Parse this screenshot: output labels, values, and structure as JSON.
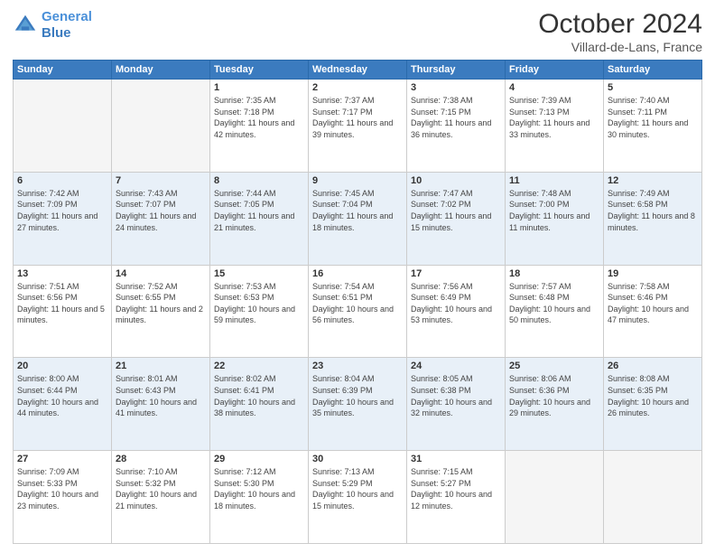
{
  "header": {
    "logo_line1": "General",
    "logo_line2": "Blue",
    "main_title": "October 2024",
    "subtitle": "Villard-de-Lans, France"
  },
  "days_of_week": [
    "Sunday",
    "Monday",
    "Tuesday",
    "Wednesday",
    "Thursday",
    "Friday",
    "Saturday"
  ],
  "weeks": [
    [
      {
        "day": "",
        "empty": true
      },
      {
        "day": "",
        "empty": true
      },
      {
        "day": "1",
        "sunrise": "7:35 AM",
        "sunset": "7:18 PM",
        "daylight": "11 hours and 42 minutes."
      },
      {
        "day": "2",
        "sunrise": "7:37 AM",
        "sunset": "7:17 PM",
        "daylight": "11 hours and 39 minutes."
      },
      {
        "day": "3",
        "sunrise": "7:38 AM",
        "sunset": "7:15 PM",
        "daylight": "11 hours and 36 minutes."
      },
      {
        "day": "4",
        "sunrise": "7:39 AM",
        "sunset": "7:13 PM",
        "daylight": "11 hours and 33 minutes."
      },
      {
        "day": "5",
        "sunrise": "7:40 AM",
        "sunset": "7:11 PM",
        "daylight": "11 hours and 30 minutes."
      }
    ],
    [
      {
        "day": "6",
        "sunrise": "7:42 AM",
        "sunset": "7:09 PM",
        "daylight": "11 hours and 27 minutes."
      },
      {
        "day": "7",
        "sunrise": "7:43 AM",
        "sunset": "7:07 PM",
        "daylight": "11 hours and 24 minutes."
      },
      {
        "day": "8",
        "sunrise": "7:44 AM",
        "sunset": "7:05 PM",
        "daylight": "11 hours and 21 minutes."
      },
      {
        "day": "9",
        "sunrise": "7:45 AM",
        "sunset": "7:04 PM",
        "daylight": "11 hours and 18 minutes."
      },
      {
        "day": "10",
        "sunrise": "7:47 AM",
        "sunset": "7:02 PM",
        "daylight": "11 hours and 15 minutes."
      },
      {
        "day": "11",
        "sunrise": "7:48 AM",
        "sunset": "7:00 PM",
        "daylight": "11 hours and 11 minutes."
      },
      {
        "day": "12",
        "sunrise": "7:49 AM",
        "sunset": "6:58 PM",
        "daylight": "11 hours and 8 minutes."
      }
    ],
    [
      {
        "day": "13",
        "sunrise": "7:51 AM",
        "sunset": "6:56 PM",
        "daylight": "11 hours and 5 minutes."
      },
      {
        "day": "14",
        "sunrise": "7:52 AM",
        "sunset": "6:55 PM",
        "daylight": "11 hours and 2 minutes."
      },
      {
        "day": "15",
        "sunrise": "7:53 AM",
        "sunset": "6:53 PM",
        "daylight": "10 hours and 59 minutes."
      },
      {
        "day": "16",
        "sunrise": "7:54 AM",
        "sunset": "6:51 PM",
        "daylight": "10 hours and 56 minutes."
      },
      {
        "day": "17",
        "sunrise": "7:56 AM",
        "sunset": "6:49 PM",
        "daylight": "10 hours and 53 minutes."
      },
      {
        "day": "18",
        "sunrise": "7:57 AM",
        "sunset": "6:48 PM",
        "daylight": "10 hours and 50 minutes."
      },
      {
        "day": "19",
        "sunrise": "7:58 AM",
        "sunset": "6:46 PM",
        "daylight": "10 hours and 47 minutes."
      }
    ],
    [
      {
        "day": "20",
        "sunrise": "8:00 AM",
        "sunset": "6:44 PM",
        "daylight": "10 hours and 44 minutes."
      },
      {
        "day": "21",
        "sunrise": "8:01 AM",
        "sunset": "6:43 PM",
        "daylight": "10 hours and 41 minutes."
      },
      {
        "day": "22",
        "sunrise": "8:02 AM",
        "sunset": "6:41 PM",
        "daylight": "10 hours and 38 minutes."
      },
      {
        "day": "23",
        "sunrise": "8:04 AM",
        "sunset": "6:39 PM",
        "daylight": "10 hours and 35 minutes."
      },
      {
        "day": "24",
        "sunrise": "8:05 AM",
        "sunset": "6:38 PM",
        "daylight": "10 hours and 32 minutes."
      },
      {
        "day": "25",
        "sunrise": "8:06 AM",
        "sunset": "6:36 PM",
        "daylight": "10 hours and 29 minutes."
      },
      {
        "day": "26",
        "sunrise": "8:08 AM",
        "sunset": "6:35 PM",
        "daylight": "10 hours and 26 minutes."
      }
    ],
    [
      {
        "day": "27",
        "sunrise": "7:09 AM",
        "sunset": "5:33 PM",
        "daylight": "10 hours and 23 minutes."
      },
      {
        "day": "28",
        "sunrise": "7:10 AM",
        "sunset": "5:32 PM",
        "daylight": "10 hours and 21 minutes."
      },
      {
        "day": "29",
        "sunrise": "7:12 AM",
        "sunset": "5:30 PM",
        "daylight": "10 hours and 18 minutes."
      },
      {
        "day": "30",
        "sunrise": "7:13 AM",
        "sunset": "5:29 PM",
        "daylight": "10 hours and 15 minutes."
      },
      {
        "day": "31",
        "sunrise": "7:15 AM",
        "sunset": "5:27 PM",
        "daylight": "10 hours and 12 minutes."
      },
      {
        "day": "",
        "empty": true
      },
      {
        "day": "",
        "empty": true
      }
    ]
  ],
  "labels": {
    "sunrise": "Sunrise:",
    "sunset": "Sunset:",
    "daylight": "Daylight:"
  }
}
